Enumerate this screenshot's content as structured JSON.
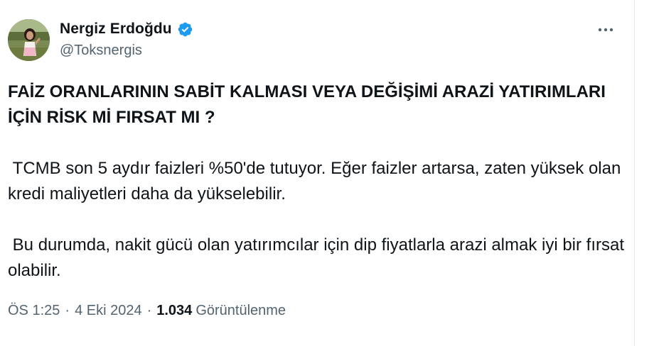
{
  "author": {
    "display_name": "Nergiz Erdoğdu",
    "handle": "@Toksnergis",
    "verified_color": "#1d9bf0"
  },
  "icons": {
    "verified": "verified-badge-icon",
    "more": "more-options-icon"
  },
  "tweet": {
    "title": "FAİZ ORANLARININ SABİT KALMASI VEYA DEĞİŞİMİ ARAZİ YATIRIMLARI İÇİN RİSK Mİ FIRSAT MI ?",
    "paragraph_1": " TCMB son 5 aydır faizleri %50'de tutuyor. Eğer faizler artarsa, zaten yüksek olan kredi maliyetleri daha da yükselebilir.",
    "paragraph_2": " Bu durumda, nakit gücü olan yatırımcılar için dip fiyatlarla arazi almak iyi bir fırsat olabilir."
  },
  "meta": {
    "time": "ÖS 1:25",
    "date": "4 Eki 2024",
    "separator": "·",
    "views_count": "1.034",
    "views_label": "Görüntülenme"
  }
}
